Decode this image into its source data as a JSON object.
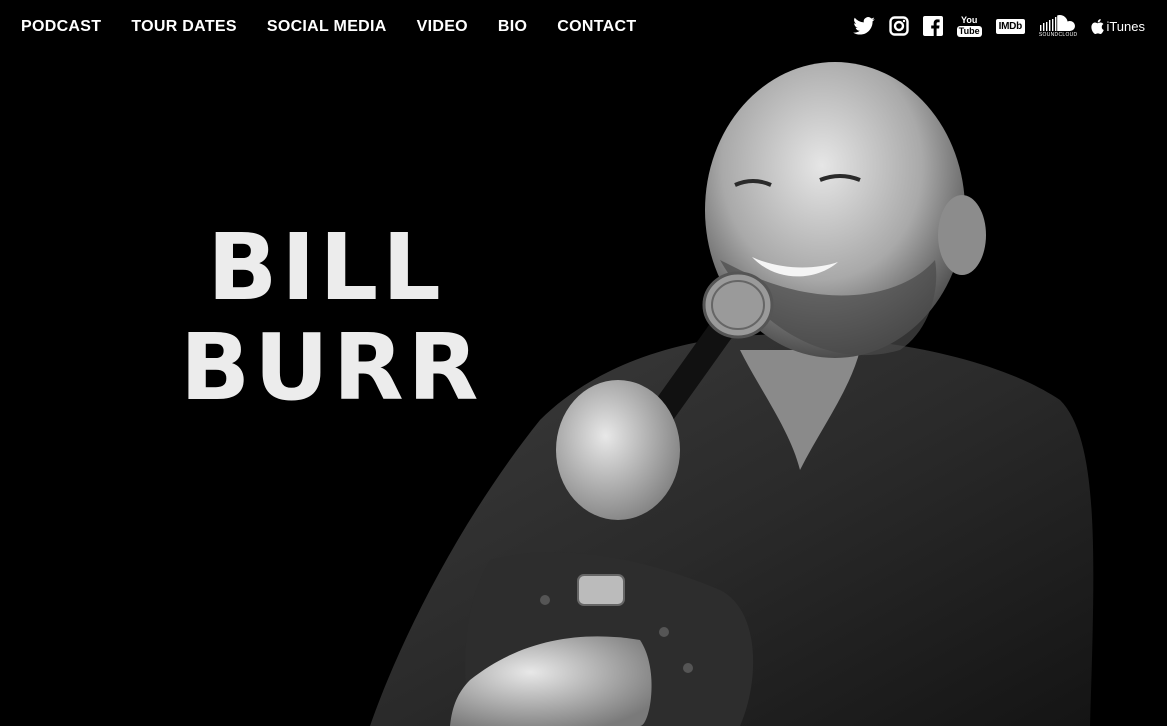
{
  "nav": {
    "items": [
      {
        "label": "PODCAST"
      },
      {
        "label": "TOUR DATES"
      },
      {
        "label": "SOCIAL MEDIA"
      },
      {
        "label": "VIDEO"
      },
      {
        "label": "BIO"
      },
      {
        "label": "CONTACT"
      }
    ]
  },
  "social": {
    "youtube_top": "You",
    "youtube_bottom": "Tube",
    "imdb": "IMDb",
    "soundcloud": "SOUNDCLOUD",
    "itunes": "iTunes",
    "icons": [
      "twitter-icon",
      "instagram-icon",
      "facebook-icon",
      "youtube-icon",
      "imdb-icon",
      "soundcloud-icon",
      "itunes-icon"
    ]
  },
  "hero": {
    "name_line1": "BILL",
    "name_line2": "BURR"
  },
  "colors": {
    "background": "#000000",
    "text": "#ffffff",
    "title": "#ececec"
  }
}
